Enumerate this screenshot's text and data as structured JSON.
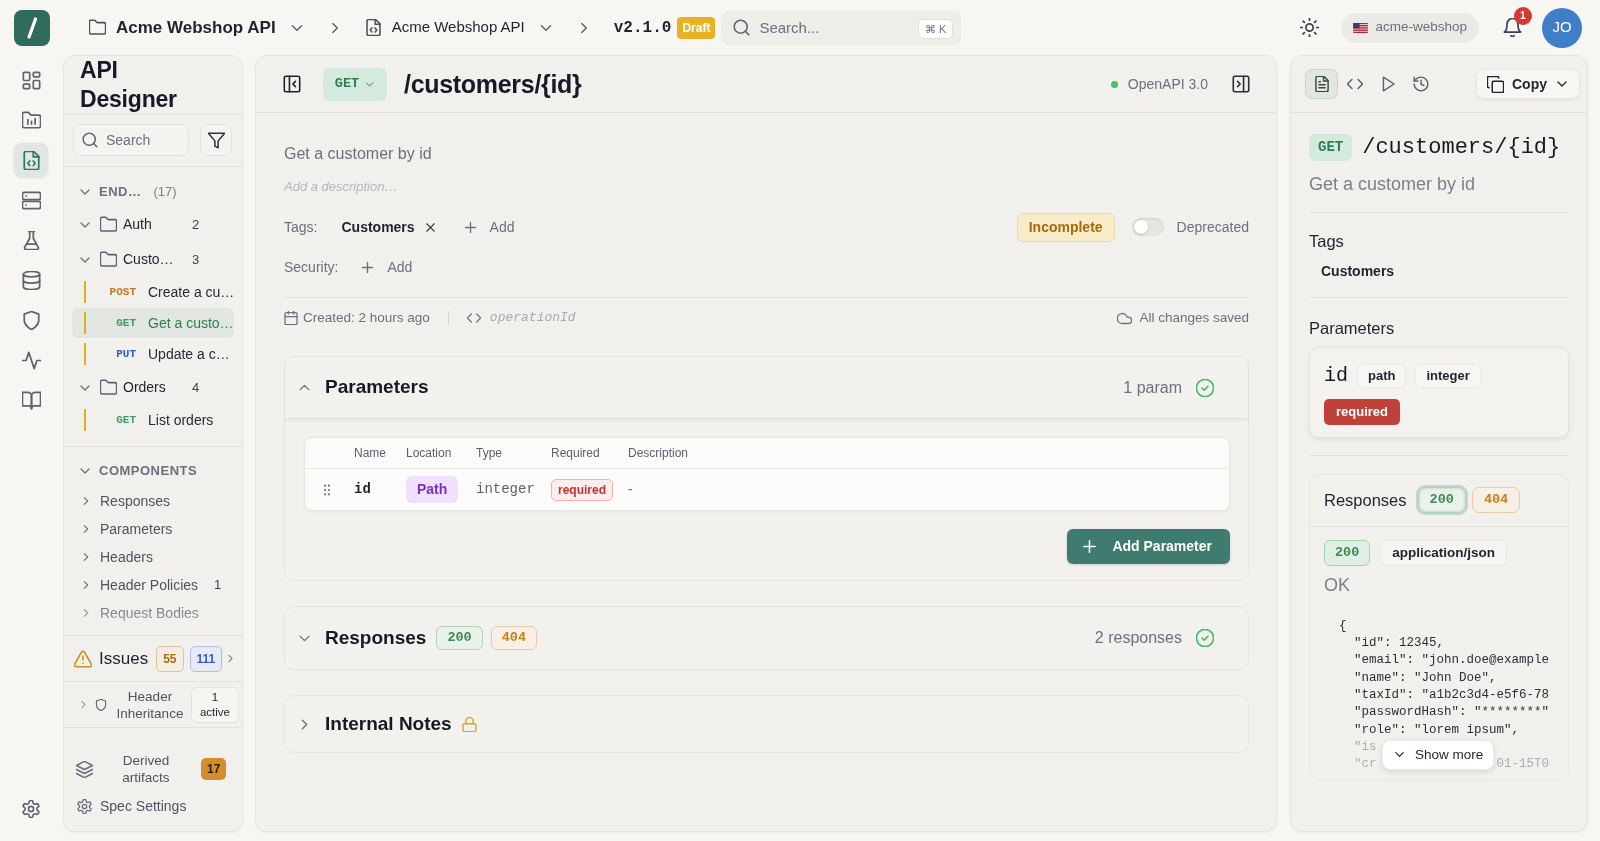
{
  "topbar": {
    "breadcrumbs": [
      {
        "kind": "project",
        "label": "Acme Webshop API"
      },
      {
        "kind": "spec",
        "label": "Acme Webshop API"
      }
    ],
    "version": "v2.1.0",
    "version_badge": "Draft",
    "search": {
      "placeholder": "Search...",
      "shortcut": "⌘ K"
    },
    "workspace": "acme-webshop",
    "notifications": "1",
    "avatar": "JO"
  },
  "rail": {
    "items": [
      {
        "selected": false
      },
      {
        "selected": false
      },
      {
        "selected": true
      },
      {
        "selected": false
      },
      {
        "selected": false
      },
      {
        "selected": false
      },
      {
        "selected": false
      },
      {
        "selected": false
      },
      {
        "selected": false
      }
    ]
  },
  "sidebar": {
    "title": "API Designer",
    "search": {
      "placeholder": "Search"
    },
    "endpoints": {
      "label": "END…",
      "count": "(17)",
      "expanded": true,
      "folders": [
        {
          "label": "Auth",
          "count": "2",
          "expanded": true
        },
        {
          "label": "Custo…",
          "count": "3",
          "expanded": true,
          "children": [
            {
              "method": "POST",
              "color": "#c8731a",
              "label": "Create a cu…",
              "selected": false
            },
            {
              "method": "GET",
              "color": "#3d9b6e",
              "label": "Get a custo…",
              "selected": true
            },
            {
              "method": "PUT",
              "color": "#3357d6",
              "label": "Update a c…",
              "selected": false
            }
          ]
        },
        {
          "label": "Orders",
          "count": "4",
          "expanded": true,
          "children": [
            {
              "method": "GET",
              "color": "#3d9b6e",
              "label": "List orders",
              "selected": false
            }
          ]
        }
      ]
    },
    "components": {
      "label": "COMPONENTS",
      "expanded": true,
      "items": [
        {
          "label": "Responses"
        },
        {
          "label": "Parameters"
        },
        {
          "label": "Headers"
        },
        {
          "label": "Header Policies",
          "count": "1"
        },
        {
          "label": "Request Bodies"
        }
      ]
    },
    "issues": {
      "label": "Issues",
      "counts": [
        {
          "value": "55",
          "color": "#a86d0c"
        },
        {
          "value": "111",
          "color": "#3a5bcc"
        }
      ]
    },
    "header_inheritance": {
      "label": "Header Inheritance",
      "badge": "1 active",
      "expanded": false
    },
    "derived": {
      "label": "Derived artifacts",
      "count": "17"
    },
    "settings": "Spec Settings"
  },
  "editor": {
    "method": "GET",
    "path": "/customers/{id}",
    "spec": "OpenAPI 3.0",
    "summary": "Get a customer by id",
    "description": {
      "placeholder": "Add a description…"
    },
    "tags": {
      "label": "Tags:",
      "items": [
        "Customers"
      ],
      "add": "Add"
    },
    "status": "Incomplete",
    "deprecated": {
      "label": "Deprecated",
      "on": false
    },
    "security": {
      "label": "Security:",
      "add": "Add"
    },
    "created": "Created: 2 hours ago",
    "operation_id": {
      "placeholder": "operationId"
    },
    "save_status": "All changes saved",
    "sections": [
      {
        "kind": "parameters",
        "title": "Parameters",
        "expanded": true,
        "summary": "1 param",
        "valid": true,
        "columns": [
          "Name",
          "Location",
          "Type",
          "Required",
          "Description"
        ],
        "rows": [
          {
            "name": "id",
            "location": "Path",
            "type": "integer",
            "required": "required",
            "description": "-"
          }
        ],
        "add_button": "Add Parameter"
      },
      {
        "kind": "responses",
        "title": "Responses",
        "expanded": false,
        "codes": [
          {
            "code": "200",
            "color": "#3d8b50"
          },
          {
            "code": "404",
            "color": "#c58022"
          }
        ],
        "summary": "2 responses",
        "valid": true
      },
      {
        "kind": "notes",
        "title": "Internal Notes",
        "expanded": false,
        "locked": true
      }
    ]
  },
  "preview": {
    "tabs": [
      {
        "selected": true
      },
      {
        "selected": false
      },
      {
        "selected": false
      },
      {
        "selected": false
      }
    ],
    "copy": "Copy",
    "method": "GET",
    "path": "/customers/{id}",
    "summary": "Get a customer by id",
    "tags_title": "Tags",
    "tags": [
      "Customers"
    ],
    "params_title": "Parameters",
    "params": [
      {
        "name": "id",
        "location": "path",
        "type": "integer",
        "required": "required"
      }
    ],
    "responses": {
      "title": "Responses",
      "codes": [
        {
          "code": "200",
          "color": "#3d8b50",
          "selected": true
        },
        {
          "code": "404",
          "color": "#c58022",
          "selected": false
        }
      ],
      "status": "200",
      "content_type": "application/json",
      "description": "OK",
      "lines": [
        "{",
        "  \"id\": 12345,",
        "  \"email\": \"john.doe@example",
        "  \"name\": \"John Doe\",",
        "  \"taxId\": \"a1b2c3d4-e5f6-78",
        "  \"passwordHash\": \"********\"",
        "  \"role\": \"lorem ipsum\","
      ],
      "faded_lines": [
        [
          "  \"is"
        ],
        [
          "  \"cr",
          "01-15T0"
        ]
      ],
      "more": "Show more"
    }
  }
}
